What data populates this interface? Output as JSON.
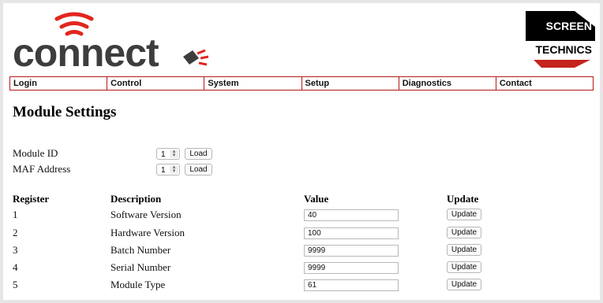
{
  "brand": {
    "logo_text": "connect",
    "partner_line1": "SCREEN",
    "partner_line2": "TECHNICS"
  },
  "nav": [
    "Login",
    "Control",
    "System",
    "Setup",
    "Diagnostics",
    "Contact"
  ],
  "page_title": "Module Settings",
  "module_id": {
    "label": "Module ID",
    "value": "1",
    "button": "Load"
  },
  "maf_address": {
    "label": "MAF Address",
    "value": "1",
    "button": "Load"
  },
  "table": {
    "headers": [
      "Register",
      "Description",
      "Value",
      "Update"
    ],
    "rows": [
      {
        "register": "1",
        "description": "Software Version",
        "value": "40",
        "button": "Update"
      },
      {
        "register": "2",
        "description": "Hardware Version",
        "value": "100",
        "button": "Update"
      },
      {
        "register": "3",
        "description": "Batch Number",
        "value": "9999",
        "button": "Update"
      },
      {
        "register": "4",
        "description": "Serial Number",
        "value": "9999",
        "button": "Update"
      },
      {
        "register": "5",
        "description": "Module Type",
        "value": "61",
        "button": "Update"
      }
    ]
  },
  "colors": {
    "accent": "#b51b1b",
    "logo_text": "#3d3d3d",
    "logo_red": "#e2261e"
  },
  "icons": [
    "wifi-signal-icon",
    "plug-icon",
    "spinner-arrows-icon"
  ]
}
